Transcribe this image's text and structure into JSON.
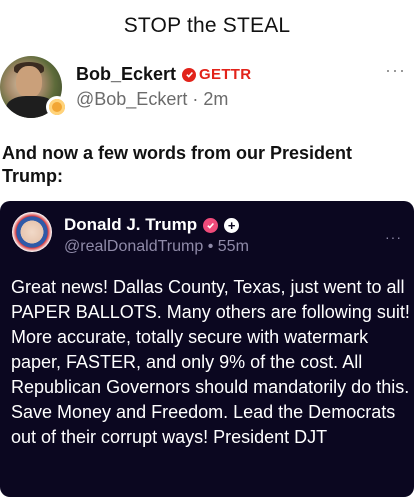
{
  "header": {
    "title": "STOP the STEAL"
  },
  "post": {
    "author_name": "Bob_Eckert",
    "platform": "GETTR",
    "handle": "@Bob_Eckert",
    "separator": "·",
    "time": "2m",
    "more": "···",
    "text": "And now a few words from our President Trump:"
  },
  "embed": {
    "author_name": "Donald J. Trump",
    "plus": "+",
    "handle": "@realDonaldTrump",
    "separator": "•",
    "time": "55m",
    "more": "···",
    "text": "Great news! Dallas County, Texas, just went to all PAPER BALLOTS. Many others are following suit! More accurate, totally secure with watermark paper, FASTER, and only 9% of the cost. All Republican Governors should mandatorily do this. Save Money and Freedom. Lead the Democrats out of their corrupt ways! President DJT"
  },
  "colors": {
    "gettr_red": "#e2231a",
    "card_bg": "#0b0720",
    "embed_verified": "#ef4b7a"
  }
}
